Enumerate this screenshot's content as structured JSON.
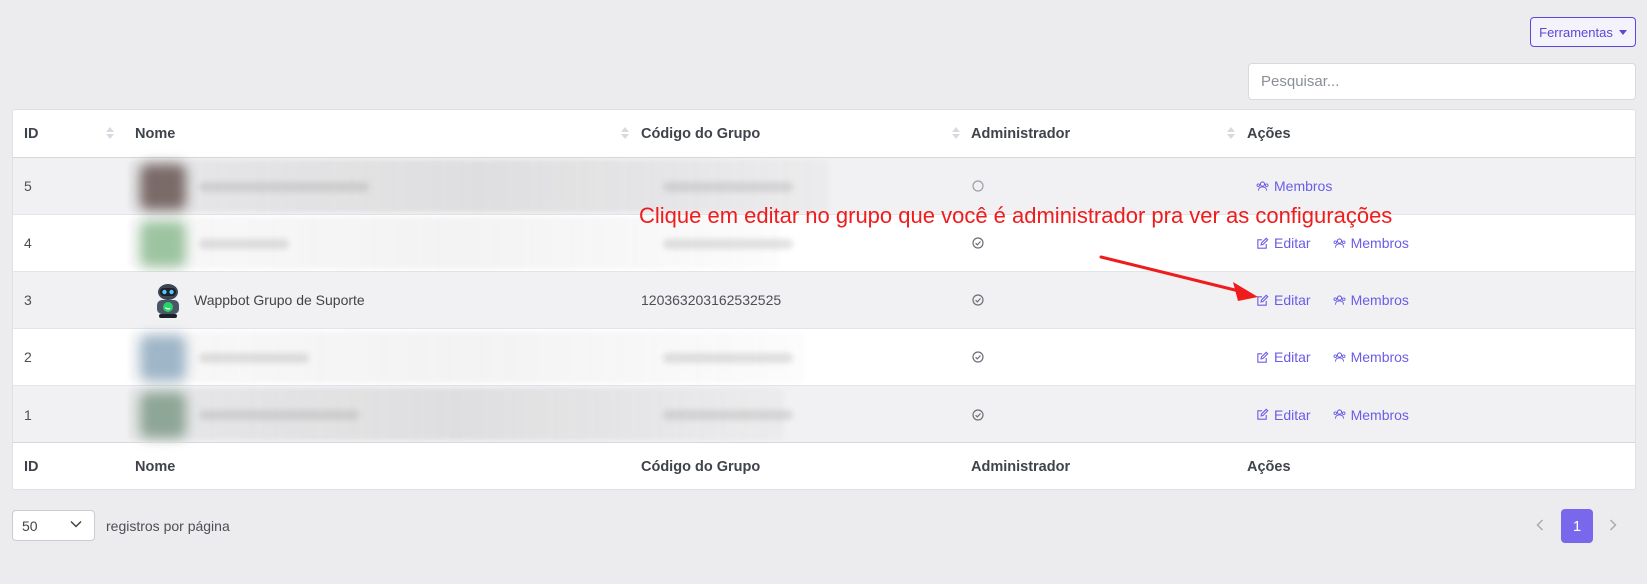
{
  "header": {
    "tools_label": "Ferramentas",
    "search_placeholder": "Pesquisar..."
  },
  "table": {
    "columns": [
      "ID",
      "Nome",
      "Código do Grupo",
      "Administrador",
      "Ações"
    ],
    "rows": [
      {
        "id": "5",
        "name": "",
        "code": "",
        "admin": false,
        "actions": [
          "Membros"
        ]
      },
      {
        "id": "4",
        "name": "",
        "code": "",
        "admin": true,
        "actions": [
          "Editar",
          "Membros"
        ]
      },
      {
        "id": "3",
        "name": "Wappbot Grupo de Suporte",
        "code": "120363203162532525",
        "admin": true,
        "actions": [
          "Editar",
          "Membros"
        ]
      },
      {
        "id": "2",
        "name": "",
        "code": "",
        "admin": true,
        "actions": [
          "Editar",
          "Membros"
        ]
      },
      {
        "id": "1",
        "name": "",
        "code": "",
        "admin": true,
        "actions": [
          "Editar",
          "Membros"
        ]
      }
    ],
    "edit_label": "Editar",
    "members_label": "Membros"
  },
  "annotation": {
    "text": "Clique em editar no grupo que você é administrador pra ver as configurações",
    "color": "#ee1c1c"
  },
  "footer": {
    "per_page_value": "50",
    "per_page_label": "registros por página",
    "current_page": "1"
  },
  "colors": {
    "accent": "#6b5ce7",
    "page_button": "#7a68ec"
  }
}
